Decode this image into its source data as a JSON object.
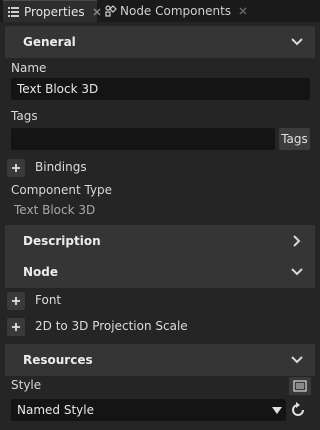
{
  "tabs": [
    {
      "label": "Properties",
      "icon": "properties-icon",
      "close_icon": "close-icon",
      "active": true
    },
    {
      "label": "Node Components",
      "icon": "node-components-icon",
      "close_icon": "close-icon",
      "active": false
    }
  ],
  "sections": {
    "general": {
      "title": "General",
      "expanded": true
    },
    "description": {
      "title": "Description",
      "expanded": false
    },
    "node": {
      "title": "Node",
      "expanded": true
    },
    "resources": {
      "title": "Resources",
      "expanded": true
    }
  },
  "general": {
    "name_label": "Name",
    "name_value": "Text Block 3D",
    "tags_label": "Tags",
    "tags_value": "",
    "tags_button": "Tags",
    "bindings_label": "Bindings",
    "component_type_label": "Component Type",
    "component_type_value": "Text Block 3D"
  },
  "node": {
    "font_label": "Font",
    "projection_label": "2D to 3D Projection Scale"
  },
  "resources": {
    "style_label": "Style",
    "style_value": "Named Style"
  },
  "colors": {
    "background": "#252525",
    "section_header": "#353535",
    "field": "#141414",
    "tabstrip": "#1a1a1a"
  }
}
